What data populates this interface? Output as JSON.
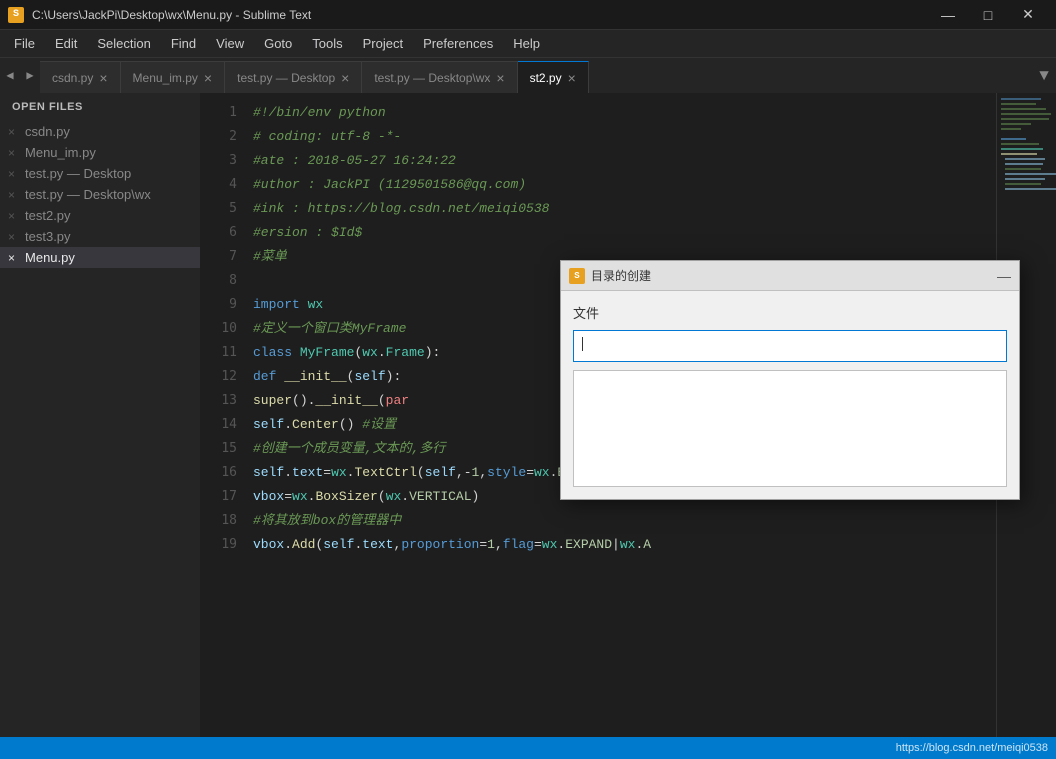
{
  "titlebar": {
    "icon": "S",
    "title": "C:\\Users\\JackPi\\Desktop\\wx\\Menu.py - Sublime Text",
    "minimize": "—",
    "maximize": "□",
    "close": "✕"
  },
  "menubar": {
    "items": [
      "File",
      "Edit",
      "Selection",
      "Find",
      "View",
      "Goto",
      "Tools",
      "Project",
      "Preferences",
      "Help"
    ]
  },
  "tabs": [
    {
      "label": "csdn.py",
      "active": false
    },
    {
      "label": "Menu_im.py",
      "active": false
    },
    {
      "label": "test.py — Desktop",
      "active": false
    },
    {
      "label": "test.py — Desktop\\wx",
      "active": false
    },
    {
      "label": "st2.py",
      "active": false
    }
  ],
  "sidebar": {
    "header": "OPEN FILES",
    "files": [
      {
        "name": "csdn.py",
        "active": false,
        "modified": false
      },
      {
        "name": "Menu_im.py",
        "active": false,
        "modified": false
      },
      {
        "name": "test.py — Desktop",
        "active": false,
        "modified": false
      },
      {
        "name": "test.py — Desktop\\wx",
        "active": false,
        "modified": false
      },
      {
        "name": "test2.py",
        "active": false,
        "modified": false
      },
      {
        "name": "test3.py",
        "active": false,
        "modified": false
      },
      {
        "name": "Menu.py",
        "active": true,
        "modified": true
      }
    ]
  },
  "code": {
    "lines": [
      {
        "num": 1,
        "content": "#!/bin/env python"
      },
      {
        "num": 2,
        "content": "# coding: utf-8 -*-"
      },
      {
        "num": 3,
        "content": "#ate    : 2018-05-27 16:24:22"
      },
      {
        "num": 4,
        "content": "#uthor  : JackPI (1129501586@qq.com)"
      },
      {
        "num": 5,
        "content": "#ink    : https://blog.csdn.net/meiqi0538"
      },
      {
        "num": 6,
        "content": "#ersion : $Id$"
      },
      {
        "num": 7,
        "content": "#菜单"
      },
      {
        "num": 8,
        "content": ""
      },
      {
        "num": 9,
        "content": "import wx"
      },
      {
        "num": 10,
        "content": "#定义一个窗口类MyFrame"
      },
      {
        "num": 11,
        "content": "class MyFrame(wx.Frame):"
      },
      {
        "num": 12,
        "content": "    def __init__(self):"
      },
      {
        "num": 13,
        "content": "        super().__init__(par"
      },
      {
        "num": 14,
        "content": "        self.Center() #设置"
      },
      {
        "num": 15,
        "content": "        #创建一个成员变量,文本的,多行"
      },
      {
        "num": 16,
        "content": "        self.text=wx.TextCtrl(self,-1,style=wx.EXPAND|wx.TE"
      },
      {
        "num": 17,
        "content": "        vbox=wx.BoxSizer(wx.VERTICAL)"
      },
      {
        "num": 18,
        "content": "        #将其放到box的管理器中"
      },
      {
        "num": 19,
        "content": "        vbox.Add(self.text,proportion=1,flag=wx.EXPAND|wx.A"
      }
    ]
  },
  "dialog": {
    "icon": "S",
    "title": "目录的创建",
    "close": "—",
    "label": "文件",
    "input_placeholder": ""
  },
  "status": {
    "url": "https://blog.csdn.net/meiqi0538"
  }
}
